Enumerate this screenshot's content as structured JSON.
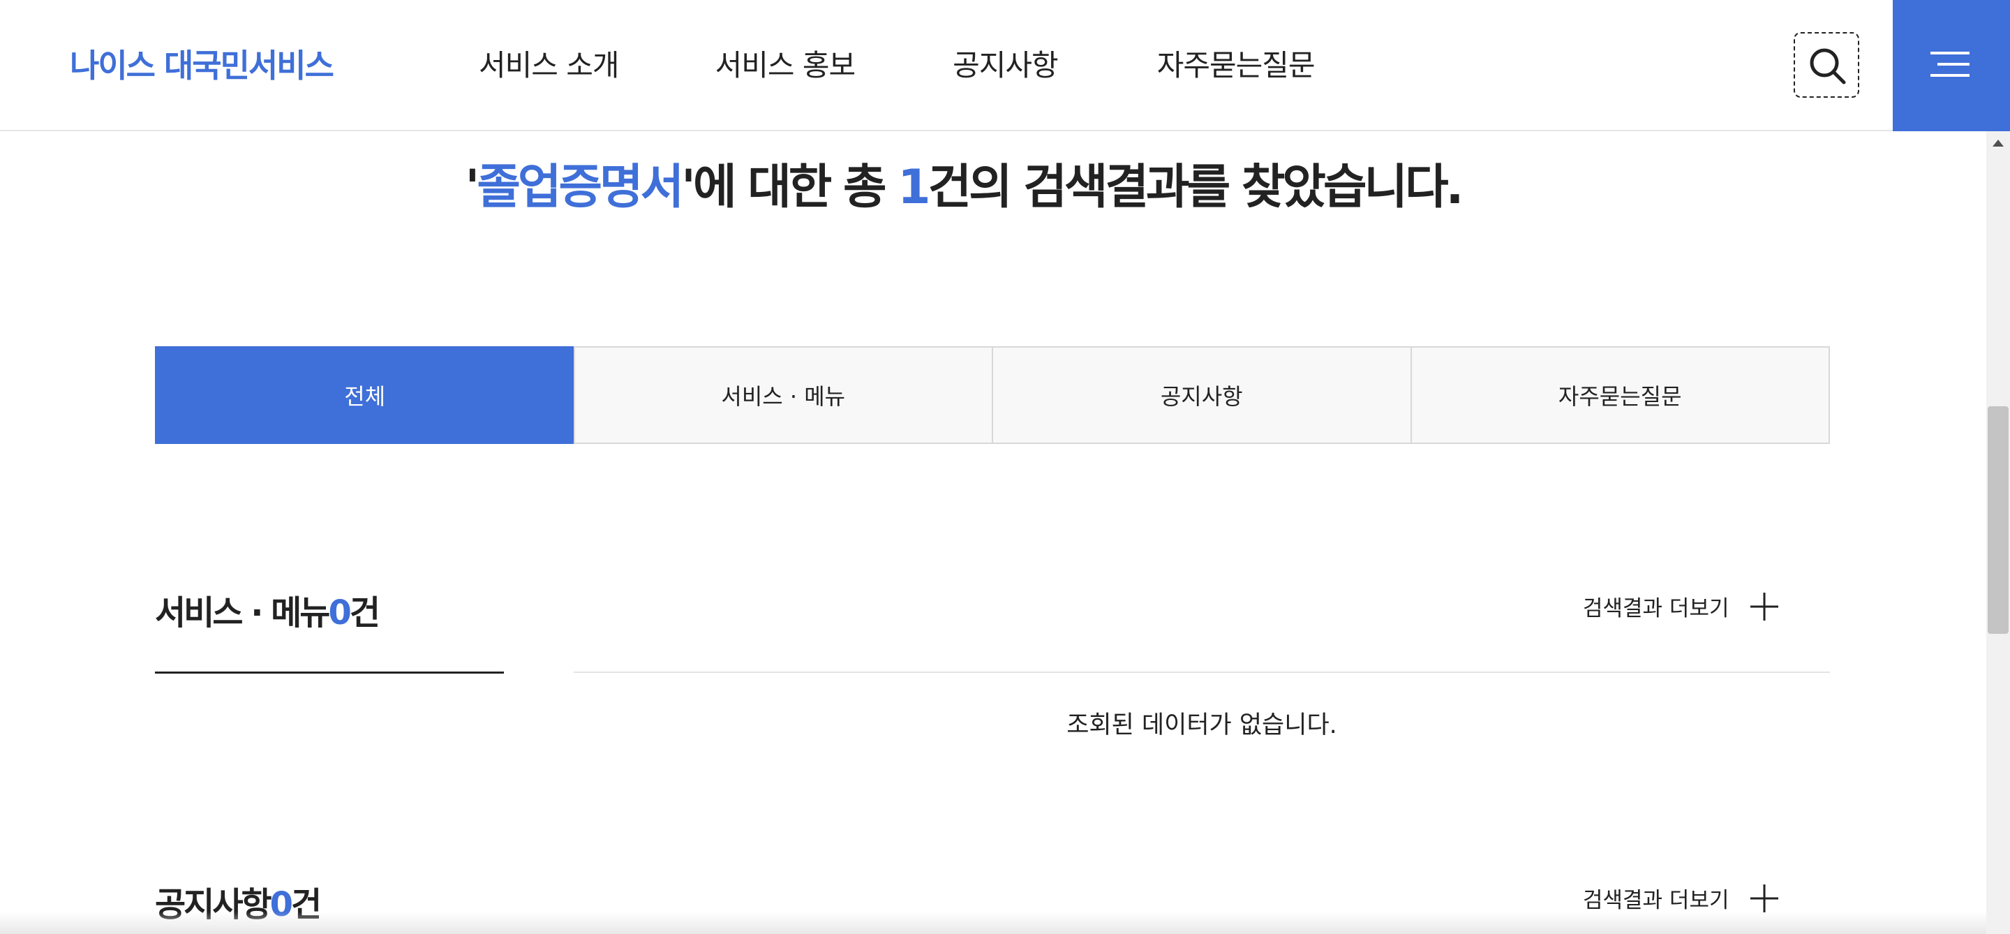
{
  "header": {
    "logo": "나이스 대국민서비스",
    "nav": [
      "서비스 소개",
      "서비스 홍보",
      "공지사항",
      "자주묻는질문"
    ],
    "icons": {
      "search": "search-icon",
      "menu": "hamburger-menu-icon"
    },
    "accent_color": "#3f6fd8"
  },
  "result": {
    "quote_open": "'",
    "keyword": "졸업증명서",
    "middle": "'에 대한 총 ",
    "count": "1",
    "suffix": "건의 검색결과를 찾았습니다."
  },
  "tabs": [
    {
      "label": "전체",
      "active": true
    },
    {
      "label": "서비스 · 메뉴",
      "active": false
    },
    {
      "label": "공지사항",
      "active": false
    },
    {
      "label": "자주묻는질문",
      "active": false
    }
  ],
  "sections": [
    {
      "title": "서비스 · 메뉴",
      "count": "0",
      "unit": "건",
      "more_label": "검색결과 더보기",
      "empty_message": "조회된 데이터가 없습니다."
    },
    {
      "title": "공지사항",
      "count": "0",
      "unit": "건",
      "more_label": "검색결과 더보기"
    }
  ]
}
